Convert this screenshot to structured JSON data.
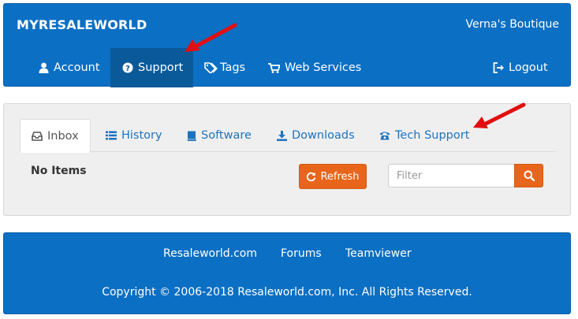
{
  "header": {
    "brand": "MYRESALEWORLD",
    "store_name": "Verna's Boutique",
    "nav": {
      "account": "Account",
      "support": "Support",
      "tags": "Tags",
      "web_services": "Web Services",
      "logout": "Logout"
    }
  },
  "panel": {
    "tabs": {
      "inbox": "Inbox",
      "history": "History",
      "software": "Software",
      "downloads": "Downloads",
      "tech_support": "Tech Support"
    },
    "empty_text": "No Items",
    "refresh_label": "Refresh",
    "filter_placeholder": "Filter"
  },
  "footer": {
    "links": {
      "resaleworld": "Resaleworld.com",
      "forums": "Forums",
      "teamviewer": "Teamviewer"
    },
    "copyright": "Copyright © 2006-2018 Resaleworld.com, Inc. All Rights Reserved."
  },
  "colors": {
    "primary_blue": "#0b6fc4",
    "active_nav": "#0a5a99",
    "accent_orange": "#e8651c",
    "annotation_red": "#e01010"
  },
  "icons": {
    "account": "user-icon",
    "support": "question-circle-icon",
    "tags": "tags-icon",
    "web_services": "cart-icon",
    "logout": "logout-icon",
    "inbox": "inbox-icon",
    "history": "list-icon",
    "software": "book-icon",
    "downloads": "download-icon",
    "tech_support": "phone-icon",
    "refresh": "refresh-icon",
    "search": "search-icon"
  }
}
